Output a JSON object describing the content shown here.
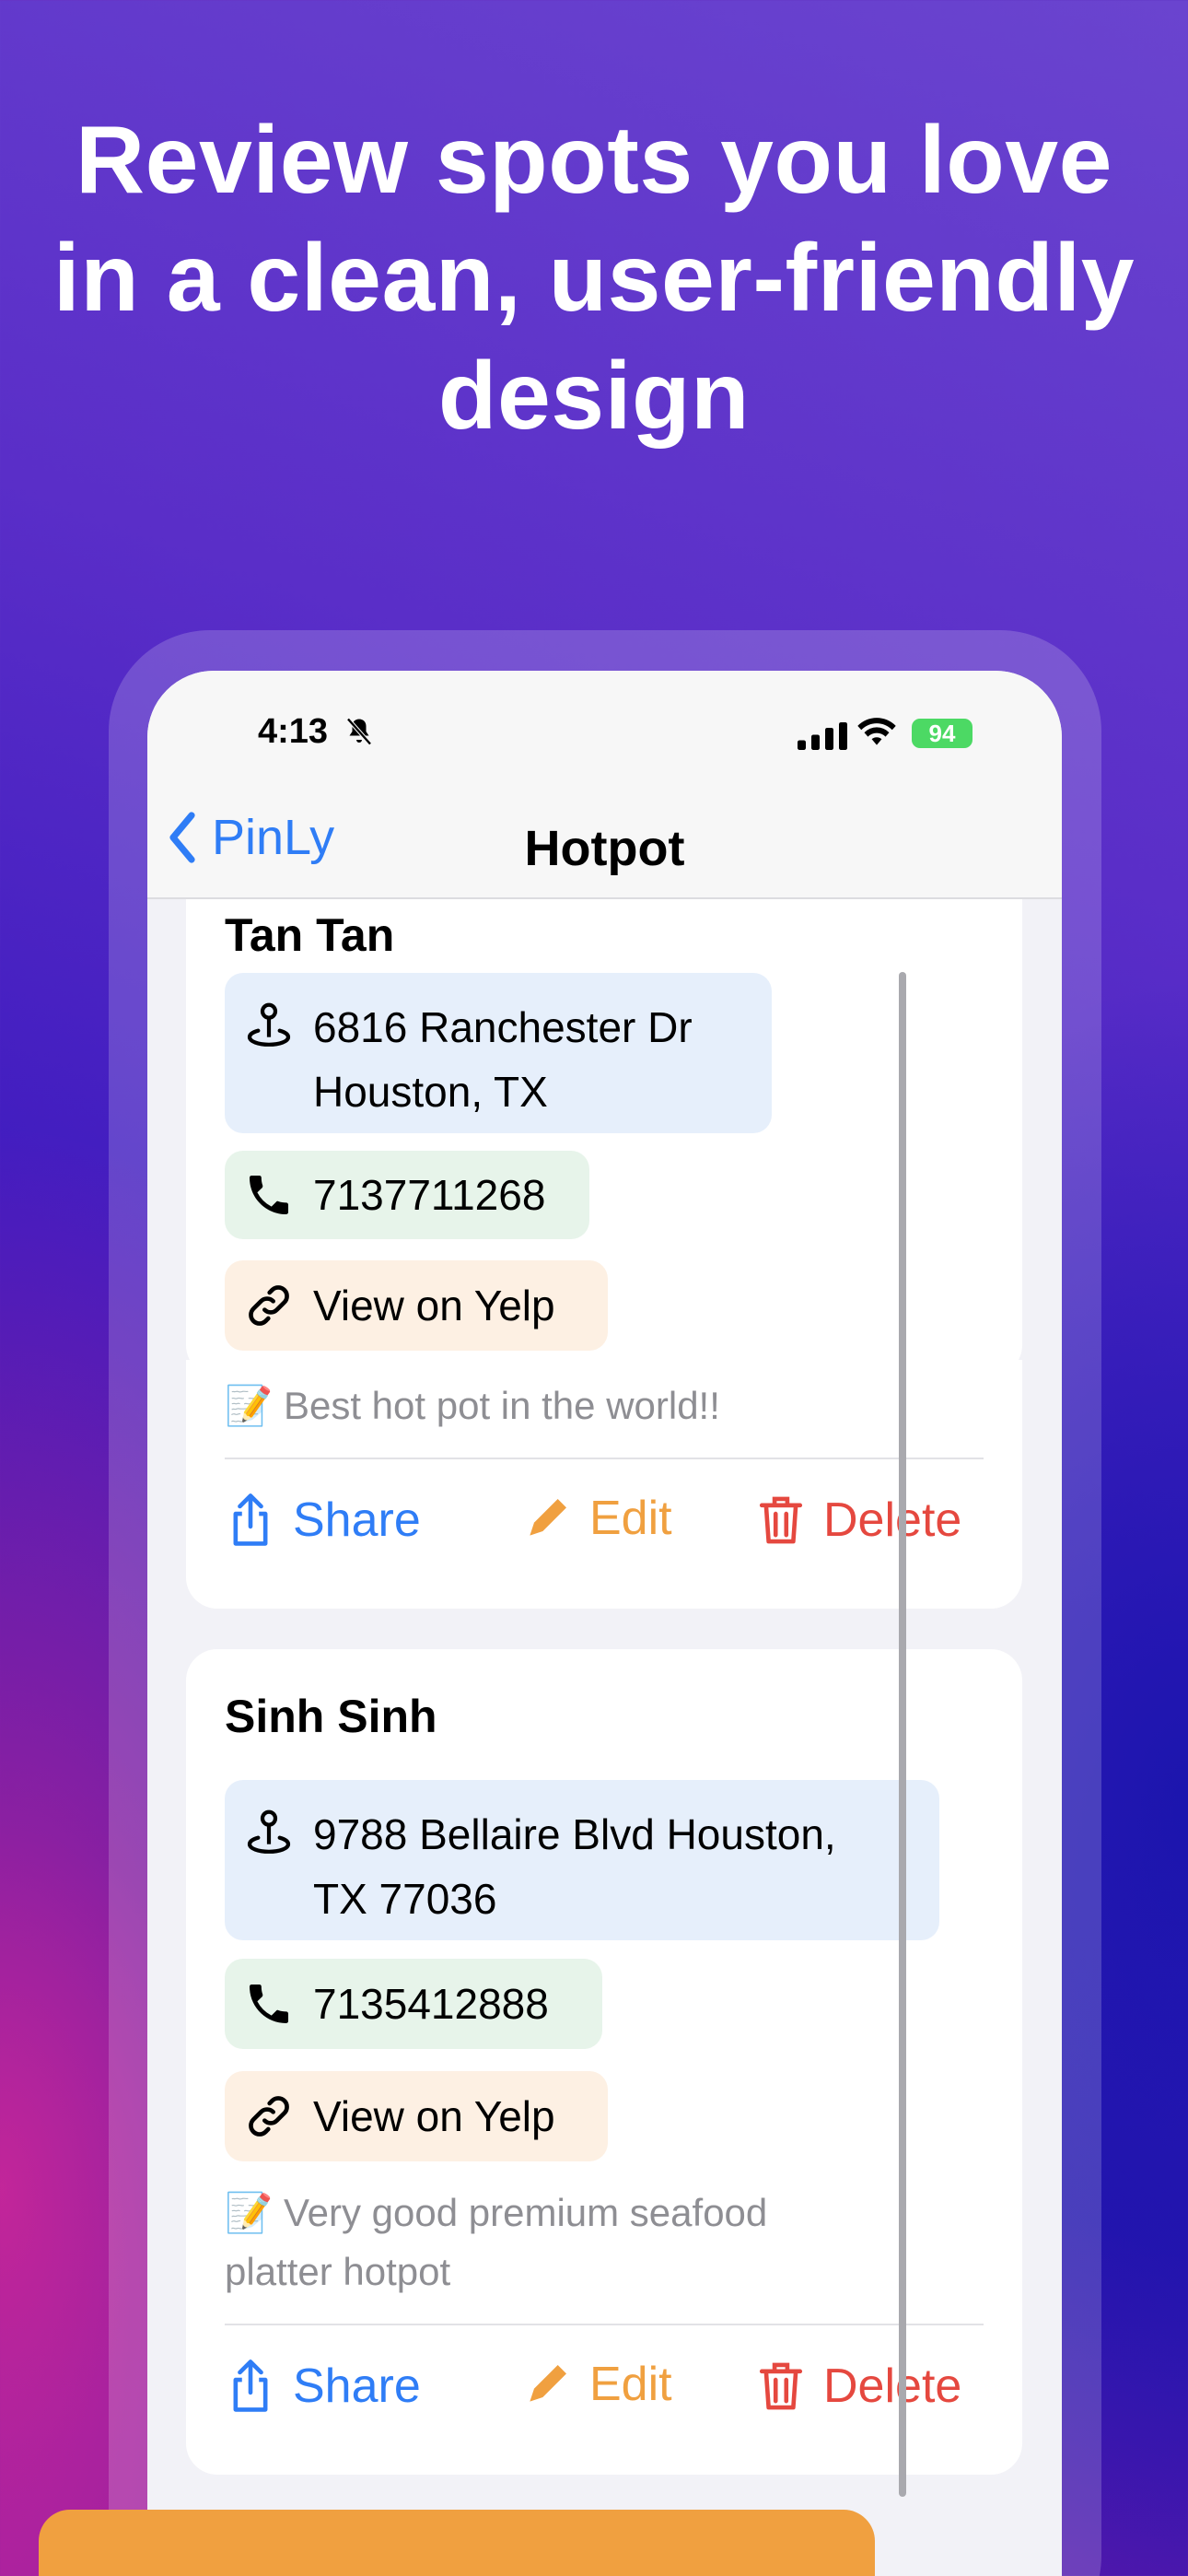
{
  "headline": {
    "line1": "Review spots you love",
    "line2": "in a clean, user-friendly",
    "line3": "design"
  },
  "status_bar": {
    "time": "4:13",
    "battery": "94"
  },
  "nav": {
    "back_label": "PinLy",
    "title": "Hotpot"
  },
  "places": [
    {
      "name": "Tan Tan",
      "address_line1": "6816 Ranchester Dr",
      "address_line2": "Houston, TX",
      "phone": "7137711268",
      "yelp_label": "View on Yelp",
      "note": "📝 Best hot pot in the world!!"
    },
    {
      "name": "Sinh Sinh",
      "address_line1": "9788 Bellaire Blvd Houston,",
      "address_line2": "TX 77036",
      "phone": "7135412888",
      "yelp_label": "View on Yelp",
      "note_line1": "📝 Very good premium seafood",
      "note_line2": "platter hotpot"
    }
  ],
  "actions": {
    "share": "Share",
    "edit": "Edit",
    "delete": "Delete"
  },
  "colors": {
    "accent_blue": "#2f7df6",
    "edit_orange": "#f0a040",
    "delete_red": "#e5483f",
    "address_bg": "#e6effb",
    "phone_bg": "#e7f4ea",
    "yelp_bg": "#fdf0e3"
  },
  "icons": {
    "address": "map-pin-icon",
    "phone": "phone-icon",
    "yelp": "link-icon",
    "share": "share-icon",
    "edit": "pencil-icon",
    "delete": "trash-icon"
  }
}
